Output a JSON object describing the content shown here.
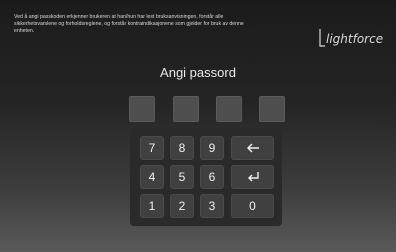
{
  "disclaimer": "Ved å angi passkoden erkjenner brukeren at han/hun har lest bruksanvisningen, forstår alle\nsikkerhetsvarslene og forholdsreglene, og forstår kontraindikasjonene som gjelder for bruk av denne\nenheten.",
  "logo": {
    "text": "lightforce"
  },
  "prompt": "Angi passord",
  "pin": {
    "length": 4
  },
  "keypad": {
    "row1": [
      "7",
      "8",
      "9"
    ],
    "row2": [
      "4",
      "5",
      "6"
    ],
    "row3": [
      "1",
      "2",
      "3"
    ],
    "zero": "0",
    "backspace_icon": "arrow-left-icon",
    "enter_icon": "return-arrow-icon"
  },
  "colors": {
    "text": "#e8e8e8",
    "key_bg": "#404040",
    "pin_box": "#4e4e4e"
  }
}
